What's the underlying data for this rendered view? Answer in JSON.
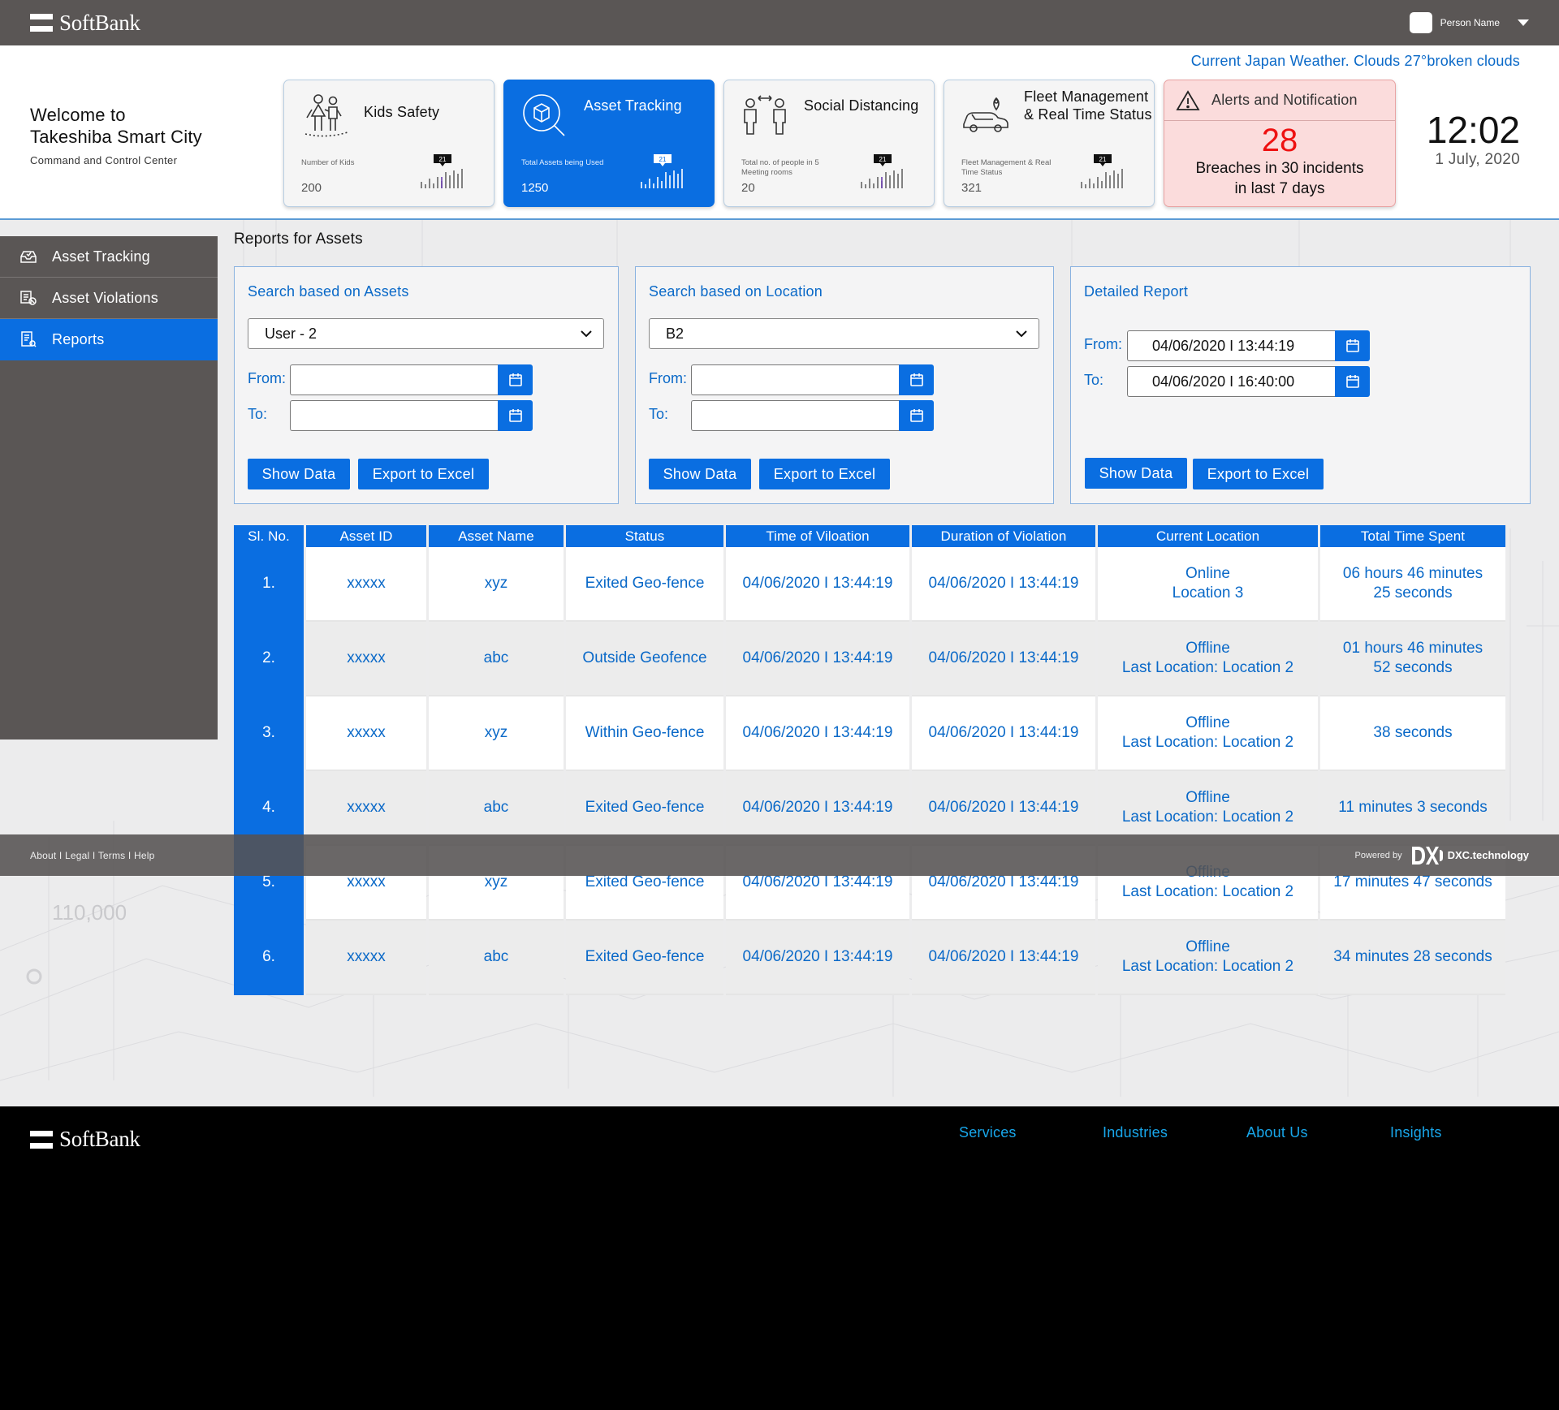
{
  "brand": "SoftBank",
  "user": {
    "name": "Person Name"
  },
  "weather": "Current Japan Weather. Clouds 27°broken clouds",
  "welcome": {
    "line1": "Welcome to",
    "line2": "Takeshiba Smart City",
    "line3": "Command and Control Center"
  },
  "cards": [
    {
      "title": "Kids Safety",
      "small": "Number of Kids",
      "value": "200",
      "badge": "21",
      "icon": "family-icon"
    },
    {
      "title": "Asset Tracking",
      "small": "Total Assets being Used",
      "value": "1250",
      "badge": "21",
      "icon": "asset-search-icon"
    },
    {
      "title": "Social Distancing",
      "small": "Total no. of people in 5 Meeting rooms",
      "value": "20",
      "badge": "21",
      "icon": "distance-people-icon"
    },
    {
      "title": "Fleet Management & Real Time Status",
      "small": "Fleet Management & Real Time Status",
      "value": "321",
      "badge": "21",
      "icon": "car-location-icon"
    }
  ],
  "alert": {
    "title": "Alerts and Notification",
    "count": "28",
    "line1": "Breaches in 30 incidents",
    "line2": "in last 7 days"
  },
  "clock": {
    "time": "12:02",
    "date": "1 July, 2020"
  },
  "sidebar": {
    "items": [
      {
        "label": "Asset Tracking",
        "icon": "inbox-icon"
      },
      {
        "label": "Asset Violations",
        "icon": "violation-icon"
      },
      {
        "label": "Reports",
        "icon": "report-icon"
      }
    ]
  },
  "page_title": "Reports for Assets",
  "panels": {
    "assets": {
      "heading": "Search based on Assets",
      "selected": "User - 2",
      "from_label": "From:",
      "to_label": "To:",
      "from_value": "",
      "to_value": ""
    },
    "location": {
      "heading": "Search based on Location",
      "selected": "B2",
      "from_label": "From:",
      "to_label": "To:",
      "from_value": "",
      "to_value": ""
    },
    "detailed": {
      "heading": "Detailed Report",
      "from_label": "From:",
      "to_label": "To:",
      "from_value": "04/06/2020 I 13:44:19",
      "to_value": "04/06/2020 I 16:40:00"
    }
  },
  "buttons": {
    "show": "Show Data",
    "export": "Export to Excel"
  },
  "table": {
    "headers": [
      "Sl. No.",
      "Asset ID",
      "Asset Name",
      "Status",
      "Time of Viloation",
      "Duration of Violation",
      "Current Location",
      "Total Time Spent"
    ],
    "rows": [
      {
        "no": "1.",
        "id": "xxxxx",
        "name": "xyz",
        "status": "Exited Geo-fence",
        "time": "04/06/2020 I 13:44:19",
        "duration": "04/06/2020 I 13:44:19",
        "loc1": "Online",
        "loc2": "Location 3",
        "spent1": "06 hours 46 minutes",
        "spent2": "25 seconds"
      },
      {
        "no": "2.",
        "id": "xxxxx",
        "name": "abc",
        "status": "Outside Geofence",
        "time": "04/06/2020 I 13:44:19",
        "duration": "04/06/2020 I 13:44:19",
        "loc1": "Offline",
        "loc2": "Last Location: Location 2",
        "spent1": "01 hours 46 minutes",
        "spent2": "52 seconds"
      },
      {
        "no": "3.",
        "id": "xxxxx",
        "name": "xyz",
        "status": "Within Geo-fence",
        "time": "04/06/2020 I 13:44:19",
        "duration": "04/06/2020 I 13:44:19",
        "loc1": "Offline",
        "loc2": "Last Location: Location 2",
        "spent1": "38 seconds",
        "spent2": ""
      },
      {
        "no": "4.",
        "id": "xxxxx",
        "name": "abc",
        "status": "Exited Geo-fence",
        "time": "04/06/2020 I 13:44:19",
        "duration": "04/06/2020 I 13:44:19",
        "loc1": "Offline",
        "loc2": "Last Location: Location 2",
        "spent1": "11 minutes 3 seconds",
        "spent2": ""
      },
      {
        "no": "5.",
        "id": "xxxxx",
        "name": "xyz",
        "status": "Exited Geo-fence",
        "time": "04/06/2020 I 13:44:19",
        "duration": "04/06/2020 I 13:44:19",
        "loc1": "Offline",
        "loc2": "Last Location: Location 2",
        "spent1": "17 minutes 47 seconds",
        "spent2": ""
      },
      {
        "no": "6.",
        "id": "xxxxx",
        "name": "abc",
        "status": "Exited Geo-fence",
        "time": "04/06/2020 I 13:44:19",
        "duration": "04/06/2020 I 13:44:19",
        "loc1": "Offline",
        "loc2": "Last Location: Location 2",
        "spent1": "34 minutes 28 seconds",
        "spent2": ""
      }
    ]
  },
  "overlay_footer": {
    "links": "About I Legal I Terms I Help",
    "powered": "Powered by",
    "partner": "DXC.technology"
  },
  "background_text": "110,000",
  "footer": {
    "links": [
      "Services",
      "Industries",
      "About Us",
      "Insights"
    ]
  },
  "colors": {
    "primary": "#0a6ee1",
    "link": "#0a69c8",
    "topbar": "#5a5655",
    "alert_bg": "#fbdcdc",
    "alert_number": "#ee1111",
    "footer_link": "#18a6ea"
  }
}
